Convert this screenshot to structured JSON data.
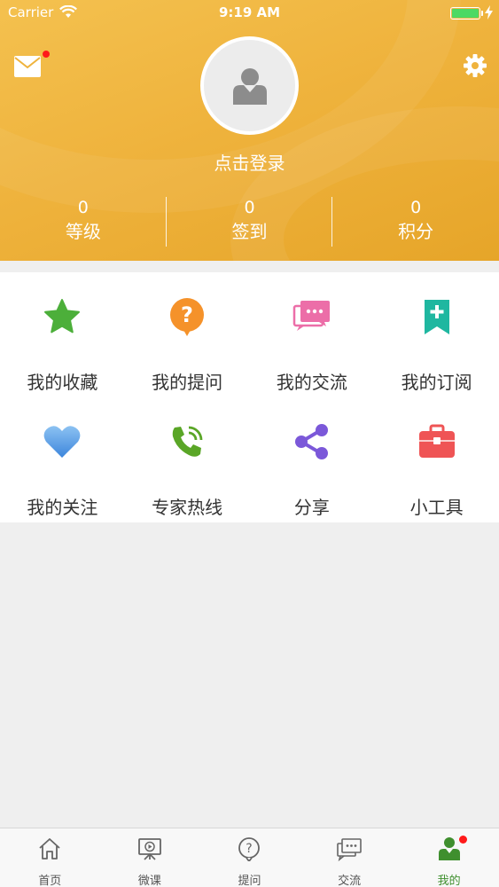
{
  "status_bar": {
    "carrier": "Carrier",
    "time": "9:19 AM"
  },
  "header": {
    "login_label": "点击登录"
  },
  "stats": [
    {
      "value": "0",
      "label": "等级"
    },
    {
      "value": "0",
      "label": "签到"
    },
    {
      "value": "0",
      "label": "积分"
    }
  ],
  "menu": [
    {
      "label": "我的收藏",
      "icon": "star-icon",
      "color": "#4caf3a"
    },
    {
      "label": "我的提问",
      "icon": "question-bubble-icon",
      "color": "#f5922a"
    },
    {
      "label": "我的交流",
      "icon": "chat-icon",
      "color": "#ec6ea8"
    },
    {
      "label": "我的订阅",
      "icon": "bookmark-add-icon",
      "color": "#1fb7a0"
    },
    {
      "label": "我的关注",
      "icon": "heart-icon",
      "color": "#4d9ee8"
    },
    {
      "label": "专家热线",
      "icon": "phone-icon",
      "color": "#5aa627"
    },
    {
      "label": "分享",
      "icon": "share-icon",
      "color": "#7b58d9"
    },
    {
      "label": "小工具",
      "icon": "toolbox-icon",
      "color": "#ef5455"
    }
  ],
  "tabs": [
    {
      "label": "首页",
      "icon": "home-icon"
    },
    {
      "label": "微课",
      "icon": "video-lesson-icon"
    },
    {
      "label": "提问",
      "icon": "question-icon"
    },
    {
      "label": "交流",
      "icon": "chat-icon"
    },
    {
      "label": "我的",
      "icon": "user-icon",
      "active": true
    }
  ]
}
